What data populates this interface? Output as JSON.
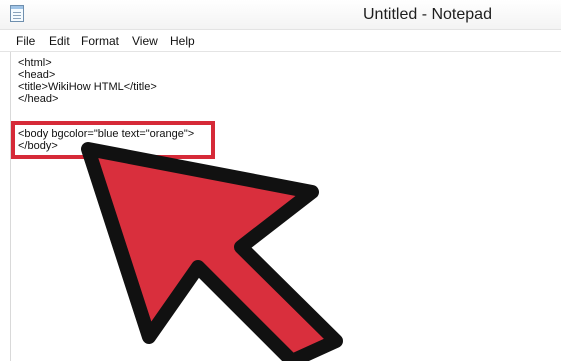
{
  "window": {
    "title": "Untitled - Notepad"
  },
  "menu": {
    "items": [
      "File",
      "Edit",
      "Format",
      "View",
      "Help"
    ]
  },
  "editor": {
    "lines": [
      "<html>",
      "<head>",
      "<title>WikiHow HTML</title>",
      "</head>",
      "",
      "<body bgcolor=\"blue text=\"orange\">",
      "</body>"
    ]
  },
  "annotation": {
    "highlight_color": "#d62a38",
    "arrow_color": "#d92f3d",
    "arrow_outline_color": "#111111"
  }
}
